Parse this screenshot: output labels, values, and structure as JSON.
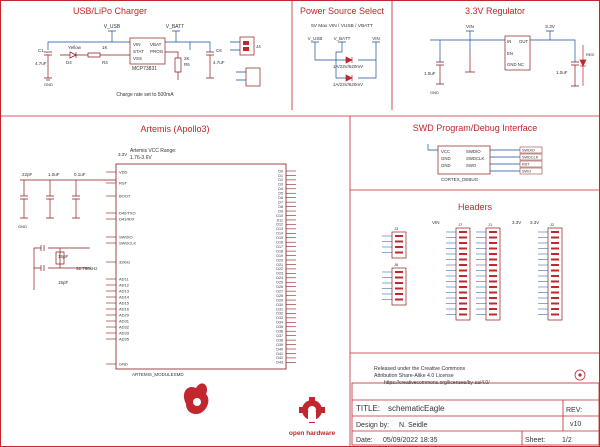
{
  "sections": {
    "charger": "USB/LiPo Charger",
    "power_select": "Power Source Select",
    "regulator": "3.3V Regulator",
    "artemis": "Artemis (Apollo3)",
    "swd": "SWD Program/Debug Interface",
    "headers": "Headers"
  },
  "charger": {
    "v_usb": "V_USB",
    "v_batt": "V_BATT",
    "ic_name": "MCP73831",
    "ic_pins": [
      "VIN",
      "STAT",
      "VSS",
      "VBAT",
      "PROG"
    ],
    "cap_c1": "C1",
    "cap_c1_val": "4.7uF",
    "led": "Yellow",
    "led_ref": "D4",
    "res1": "1K",
    "res1_ref": "R4",
    "res2": "2K",
    "res2_ref": "R6",
    "cap_c6": "C6",
    "cap_c6_val": "4.7uF",
    "jack": "J4",
    "note": "Charge rate set to 500mA",
    "gnd": "GND"
  },
  "power_select": {
    "subtitle": "5V Max VIN / VUSB / VBATT",
    "v_usb": "V_USB",
    "v_batt": "V_BATT",
    "vin": "VIN",
    "diode1": "1A/23V/620mV",
    "diode2": "1A/23V/620mV"
  },
  "regulator": {
    "vin": "VIN",
    "v33": "3.3V",
    "pins": [
      "IN",
      "OUT",
      "EN",
      "GND NC"
    ],
    "cap_in": "1.0uF",
    "cap_out": "1.0uF",
    "led_label": "RED",
    "gnd": "GND"
  },
  "artemis": {
    "vcc_note": "Artemis VCC Range:",
    "vcc_range": "1.76-3.6V",
    "v33": "3.3V",
    "left_pins": [
      "VDD",
      "RST",
      "BOOT",
      "D40/TXO",
      "D41/RXI",
      "SWDIO",
      "SWDCLK",
      "32kHz",
      "AD11",
      "AD12",
      "AD13",
      "AD14",
      "AD15",
      "AD16",
      "AD29",
      "AD31",
      "AD32",
      "AD33",
      "AD35",
      "GND"
    ],
    "right_pins": [
      "D0",
      "D1",
      "D2",
      "D3",
      "D4",
      "D5",
      "D6",
      "D7",
      "D8",
      "D9",
      "D10",
      "D11",
      "D12",
      "D13",
      "D14",
      "D15",
      "D16",
      "D17",
      "D18",
      "D19",
      "D20",
      "D21",
      "D22",
      "D23",
      "D24",
      "D25",
      "D26",
      "D27",
      "D28",
      "D29",
      "D30",
      "D31",
      "D32",
      "D33",
      "D34",
      "D35",
      "D36",
      "D37",
      "D38",
      "D39",
      "D40",
      "D41",
      "D42",
      "D43"
    ],
    "module": "ARTEMIS_MODULESMD",
    "caps": [
      "22pF",
      "1.0uF",
      "0.1uF"
    ],
    "crystal": "32.768kHz",
    "xtal_caps": [
      "15pF",
      "15pF"
    ],
    "gnd": "GND"
  },
  "swd": {
    "pins": [
      "VCC",
      "GND",
      "GND",
      "SWDIO",
      "SWDCLK",
      "SWO"
    ],
    "connector": "CORTEX_DEBUG",
    "nets": [
      "SWDIO",
      "SWDCLK",
      "RST",
      "SWO"
    ]
  },
  "headers": {
    "vin": "VIN",
    "v33": "3.3V",
    "v33b": "3.3V",
    "connectors": [
      "J3",
      "J6",
      "J7",
      "J1",
      "J2"
    ]
  },
  "title_block": {
    "license_1": "Released under the Creative Commons",
    "license_2": "Attribution Share-Alike 4.0 License",
    "license_3": "https://creativecommons.org/licenses/by-sa/4.0/",
    "title_label": "TITLE:",
    "title_value": "schematicEagle",
    "designer_label": "Design by:",
    "designer_value": "N. Seidle",
    "rev_label": "REV:",
    "rev_value": "v10",
    "date_label": "Date:",
    "date_value": "05/09/2022 18:35",
    "sheet_label": "Sheet:",
    "sheet_value": "1/2",
    "oshw_label": "open hardware"
  },
  "colors": {
    "frame": "#c1272d",
    "wire": "#1a4f9e",
    "part": "#8b1a1a",
    "text": "#333333"
  }
}
